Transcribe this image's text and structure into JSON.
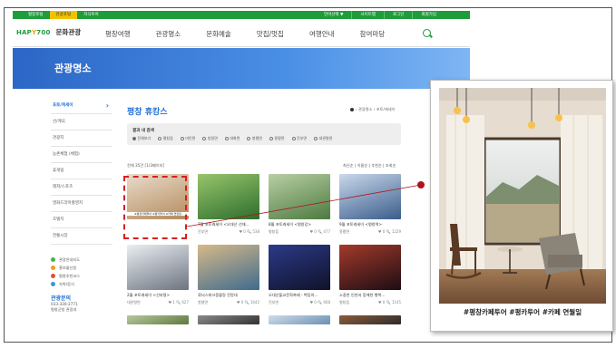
{
  "topbar": {
    "left_links": [
      "평창포털",
      "관광포털",
      "지식투어"
    ],
    "active_index": 1,
    "right_links": [
      "언어선택 ▼",
      "사이트맵",
      "로그인",
      "회원가입"
    ]
  },
  "nav": {
    "logo_text_a": "HAP",
    "logo_text_b": "Y",
    "logo_text_c": "700",
    "brand": "문화관광",
    "menu": [
      "평창여행",
      "관광명소",
      "문화예술",
      "맛집/멋집",
      "여행안내",
      "참여마당"
    ]
  },
  "banner": {
    "title": "관광명소"
  },
  "sidebar": {
    "items": [
      "포토/캐세이",
      "산/계곡",
      "관광지",
      "농촌체험 (체험)",
      "휴게림",
      "레저/스포츠",
      "영화드라마촬영지",
      "호텔지",
      "전통시장"
    ],
    "active_index": 0,
    "links": [
      {
        "label": "관광안내지도",
        "color": "#4caf50"
      },
      {
        "label": "홍보물신청",
        "color": "#f39c12"
      },
      {
        "label": "평창추천코스",
        "color": "#e74c3c"
      },
      {
        "label": "숙박/음식",
        "color": "#3498db"
      }
    ],
    "contact_title": "관광문의",
    "contact_phone": "033-330-2771",
    "contact_note": "평창군청 관광과"
  },
  "content": {
    "title": "평창 휴캉스",
    "breadcrumb": "› 관광명소 › 포토/캐세이",
    "filter_label": "결과 내 검색",
    "filter_options": [
      "전체보기",
      "평창읍",
      "미탄면",
      "방림면",
      "대화면",
      "봉평면",
      "용평면",
      "진부면",
      "대관령면"
    ],
    "filter_selected": 0,
    "count_text": "전체 35건 [1/3페이지]",
    "sort_text": "최신순 | 이름순 | 추천순 | 조회순"
  },
  "cards": [
    {
      "title": "",
      "region": "",
      "stats": "",
      "color_a": "#b58a5c",
      "color_b": "#e8dccb"
    },
    {
      "title": "7월 포토캐세이 <오대산 선재...",
      "region": "진부면",
      "stats": "♥ 0  🔍 538",
      "color_a": "#2d6e2f",
      "color_b": "#98c46a"
    },
    {
      "title": "8월 포토캐세이 <평창강>",
      "region": "평창읍",
      "stats": "♥ 0  🔍 477",
      "color_a": "#4c7a40",
      "color_b": "#b9cfa4"
    },
    {
      "title": "9월 포토캐세이 <평창역>",
      "region": "용평면",
      "stats": "♥ 0  🔍 1229",
      "color_a": "#3b5d8a",
      "color_b": "#c9d8ec"
    },
    {
      "title": "2월 포토캐세이 <선자령>",
      "region": "대관령면",
      "stats": "♥ 1  🔍 627",
      "color_a": "#6e7480",
      "color_b": "#e9eef2"
    },
    {
      "title": "휘닉스파크몽블랑 전망대",
      "region": "봉평면",
      "stats": "♥ 0  🔍 1642",
      "color_a": "#3f6b8c",
      "color_b": "#d6b98a"
    },
    {
      "title": "오대산불교문화축제 - 벽등의...",
      "region": "진부면",
      "stats": "♥ 0  🔍 668",
      "color_a": "#10122a",
      "color_b": "#2b3a88"
    },
    {
      "title": "소중한 인연과 함께한 행복...",
      "region": "평창읍",
      "stats": "♥ 0  🔍 1145",
      "color_a": "#1d0d14",
      "color_b": "#a33a2a"
    },
    {
      "title": "",
      "region": "",
      "stats": "",
      "color_a": "#5d7a3c",
      "color_b": "#b8c9a0"
    },
    {
      "title": "",
      "region": "",
      "stats": "",
      "color_a": "#333333",
      "color_b": "#8a8a8a"
    },
    {
      "title": "",
      "region": "",
      "stats": "",
      "color_a": "#6b8fb5",
      "color_b": "#d0dde8"
    },
    {
      "title": "",
      "region": "",
      "stats": "",
      "color_a": "#2c2c2c",
      "color_b": "#8c5b3a"
    }
  ],
  "card_thumb_caption": "#평창카페투어 #평카투어 #카페 연월일",
  "popout": {
    "caption": "#평창카페투어 #평카투어 #카페 연월일"
  },
  "colors": {
    "green": "#1f9c3b",
    "blue": "#1f6fd6",
    "highlight_red": "#d62020",
    "connector_red": "#b0121b"
  }
}
